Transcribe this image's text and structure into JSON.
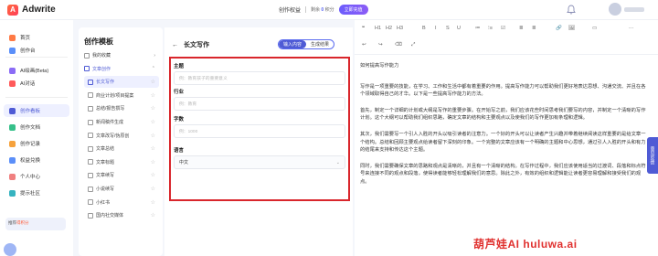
{
  "app": {
    "name": "Adwrite",
    "logo_letter": "A"
  },
  "header": {
    "rights": "创作权益",
    "remain_label": "剩余",
    "remain_value": "0",
    "remain_unit": "积分",
    "vip": "立即充值"
  },
  "sidebar": {
    "items": [
      {
        "label": "首页",
        "icon": "home-icon"
      },
      {
        "label": "创作台",
        "icon": "desk-icon"
      },
      {
        "label": "AI绘画(Beta)",
        "icon": "paint-icon"
      },
      {
        "label": "AI对话",
        "icon": "chat-icon"
      },
      {
        "label": "创作看板",
        "icon": "board-icon",
        "active": true
      },
      {
        "label": "创作文档",
        "icon": "doc-icon"
      },
      {
        "label": "创作记录",
        "icon": "record-icon"
      },
      {
        "label": "权益兑换",
        "icon": "gift-icon"
      },
      {
        "label": "个人中心",
        "icon": "user-icon"
      },
      {
        "label": "提示社区",
        "icon": "community-icon"
      }
    ],
    "promo_text": "推荐",
    "promo_tail": "得积分"
  },
  "templates": {
    "title": "创作模板",
    "items": [
      {
        "label": "我的收藏",
        "level": 0,
        "caret": "›"
      },
      {
        "label": "文章创作",
        "level": 0,
        "caret": "⌃",
        "active_parent": true
      },
      {
        "label": "长文写作",
        "level": 1,
        "active": true
      },
      {
        "label": "商业计划/项目提案",
        "level": 1
      },
      {
        "label": "总结/报告撰写",
        "level": 1
      },
      {
        "label": "新闻稿件生成",
        "level": 1
      },
      {
        "label": "文章改写/伪原创",
        "level": 1
      },
      {
        "label": "文章总结",
        "level": 1
      },
      {
        "label": "文章标题",
        "level": 1
      },
      {
        "label": "文章续写",
        "level": 1
      },
      {
        "label": "小说续写",
        "level": 1
      },
      {
        "label": "小红书",
        "level": 1
      },
      {
        "label": "国内社交媒体",
        "level": 1
      }
    ]
  },
  "form": {
    "title": "长文写作",
    "back": "←",
    "tabs": [
      "输入内容",
      "生成结果"
    ],
    "fields": [
      {
        "label": "主题",
        "placeholder": "例：教育孩子的重要意义"
      },
      {
        "label": "行业",
        "placeholder": "例：教育"
      },
      {
        "label": "字数",
        "placeholder": "例：1000"
      },
      {
        "label": "语言",
        "value": "中文"
      }
    ]
  },
  "editor": {
    "toolbar_row1": [
      "❝",
      "H1",
      "H2",
      "H3",
      "B",
      "I",
      "S",
      "U",
      "≔",
      "⁝≡",
      "☑",
      "≣",
      "≣",
      "🔗",
      "🖼",
      "▭",
      "⋯"
    ],
    "toolbar_row2": [
      "↩",
      "↪",
      "⌫",
      "⤢"
    ],
    "title": "如何提高写作能力",
    "paragraphs": [
      "写作是一项重要的技能，在学习、工作和生活中都有着重要的作用。提高写作能力可以帮助我们更好地表达思想、沟通交流、并且在各个领域取得自己的才华。以下是一些提高写作能力的方法。",
      "首先，制定一个详细的计划或大纲是写作的重要步骤。在开始写之前，我们应该花些时间思考我们要写的内容，并制定一个清晰的写作计划。这个大纲可以帮助我们组织思路，确定文章的结构和主要观点以及使我们的写作更加有条理和逻辑。",
      "其次，我们需要写一个引人入胜的开头以吸引读者的注意力。一个好的开头可以让读者产生兴趣并带着继续阅读这样重要的是给文章一个结构。总结和回顾主要观点给读者留下深刻的印象。一个完整的文章应该有一个明确的主题和中心思想，通过引人入胜的开头和有力的结尾来支持和传达这个主题。",
      "同时，我们需要确保文章的思路和观点是清晰的，并且有一个清晰的结构。在写作过程中，我们应该使用适当的过渡词、段落和标点符号来连接不同的观点和段落，使得读者能够轻松理解我们的意思。除此之外，有效的组织和逻辑能让读者更容易理解和接受我们的观点。"
    ]
  },
  "side_tab": "意见反馈",
  "watermark": {
    "a": "葫芦娃AI",
    "b": "huluwa.ai"
  }
}
